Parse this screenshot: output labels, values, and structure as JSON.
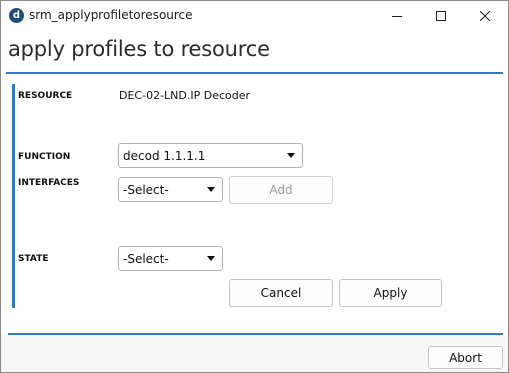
{
  "window": {
    "app_icon_letter": "d",
    "title": "srm_applyprofiletoresource"
  },
  "page": {
    "title": "apply profiles to resource"
  },
  "form": {
    "resource": {
      "label": "RESOURCE",
      "value": "DEC-02-LND.IP Decoder"
    },
    "function": {
      "label": "FUNCTION",
      "selected": "decod 1.1.1.1"
    },
    "interfaces": {
      "label": "INTERFACES",
      "selected": "-Select-",
      "add_label": "Add"
    },
    "state": {
      "label": "STATE",
      "selected": "-Select-"
    },
    "cancel_label": "Cancel",
    "apply_label": "Apply"
  },
  "footer": {
    "abort_label": "Abort"
  },
  "colors": {
    "accent": "#2e7ad1",
    "app_icon": "#1e4e79"
  }
}
